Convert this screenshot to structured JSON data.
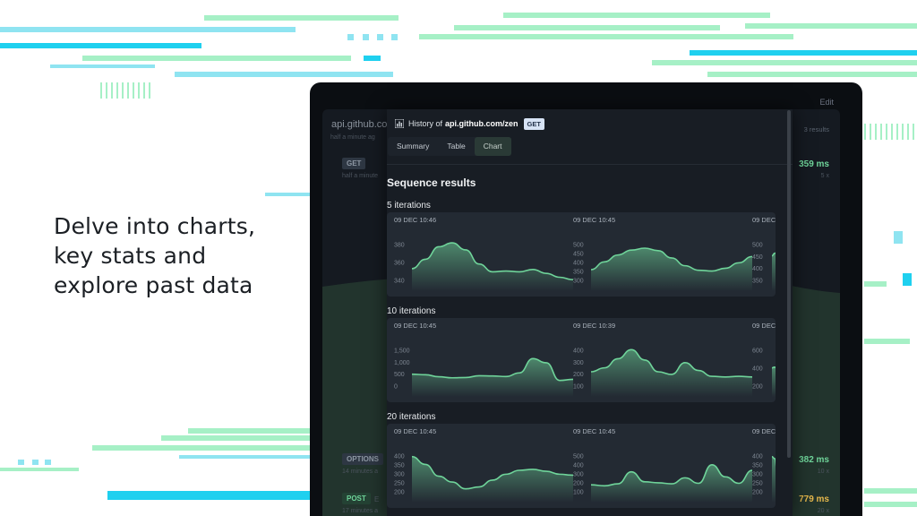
{
  "headline": [
    "Delve into charts,",
    "key stats and",
    "explore past data"
  ],
  "device": {
    "edit_label": "Edit",
    "background": {
      "title": "api.github.co",
      "subtitle": "half a minute ag",
      "results": "3 results",
      "rows": [
        {
          "method": "GET",
          "sub": "half a minute",
          "time": "359 ms",
          "iter": "5 x"
        },
        {
          "method": "OPTIONS",
          "sub": "14 minutes a",
          "time": "382 ms",
          "iter": "10 x"
        },
        {
          "method": "POST",
          "sub": "17 minutes a",
          "time": "779 ms",
          "iter": "20 x"
        }
      ],
      "post_extra": "E"
    }
  },
  "modal": {
    "history_label": "History of",
    "url": "api.github.com/zen",
    "method": "GET",
    "tabs": [
      "Summary",
      "Table",
      "Chart"
    ],
    "active_tab": "Chart",
    "heading": "Sequence results",
    "accent_color": "#6fd49a",
    "sections": [
      {
        "label": "5 iterations"
      },
      {
        "label": "10 iterations"
      },
      {
        "label": "20 iterations"
      }
    ]
  },
  "chart_data": [
    {
      "type": "area",
      "section": "5 iterations",
      "date": "09 DEC 10:46",
      "y_ticks": [
        380,
        360,
        340
      ],
      "ylim": [
        335,
        390
      ],
      "values": [
        350,
        362,
        378,
        383,
        374,
        356,
        346,
        347,
        346,
        349,
        344,
        339,
        336
      ]
    },
    {
      "type": "area",
      "section": "5 iterations",
      "date": "09 DEC 10:45",
      "y_ticks": [
        500,
        450,
        400,
        350,
        300
      ],
      "ylim": [
        290,
        510
      ],
      "values": [
        345,
        385,
        420,
        445,
        455,
        442,
        405,
        365,
        342,
        338,
        352,
        380,
        412
      ]
    },
    {
      "type": "area",
      "section": "5 iterations",
      "date": "09 DEC",
      "y_ticks": [
        500,
        450,
        400,
        350
      ],
      "ylim": [
        340,
        515
      ],
      "values": [
        440,
        450,
        455
      ]
    },
    {
      "type": "area",
      "section": "10 iterations",
      "date": "09 DEC 10:45",
      "y_ticks": [
        "1,500",
        "1,000",
        "500",
        "0"
      ],
      "ylim": [
        -60,
        1600
      ],
      "values": [
        400,
        380,
        300,
        260,
        270,
        340,
        330,
        310,
        450,
        1000,
        840,
        160,
        200
      ]
    },
    {
      "type": "area",
      "section": "10 iterations",
      "date": "09 DEC 10:39",
      "y_ticks": [
        400,
        300,
        200,
        100
      ],
      "ylim": [
        90,
        420
      ],
      "values": [
        200,
        230,
        300,
        370,
        290,
        200,
        180,
        270,
        210,
        165,
        160,
        165,
        160
      ]
    },
    {
      "type": "area",
      "section": "10 iterations",
      "date": "09 DEC",
      "y_ticks": [
        600,
        400,
        200
      ],
      "ylim": [
        180,
        700
      ],
      "values": [
        400,
        410,
        390
      ]
    },
    {
      "type": "area",
      "section": "20 iterations",
      "date": "09 DEC 10:45",
      "y_ticks": [
        400,
        350,
        300,
        250,
        200
      ],
      "ylim": [
        190,
        410
      ],
      "values": [
        370,
        330,
        270,
        240,
        205,
        215,
        250,
        280,
        300,
        305,
        295,
        280,
        275
      ]
    },
    {
      "type": "area",
      "section": "20 iterations",
      "date": "09 DEC 10:45",
      "y_ticks": [
        500,
        400,
        300,
        200,
        100
      ],
      "ylim": [
        80,
        510
      ],
      "values": [
        150,
        140,
        160,
        280,
        180,
        170,
        160,
        220,
        165,
        350,
        230,
        165,
        295
      ]
    },
    {
      "type": "area",
      "section": "20 iterations",
      "date": "09 DEC",
      "y_ticks": [
        400,
        350,
        300,
        250,
        200
      ],
      "ylim": [
        190,
        410
      ],
      "values": [
        370,
        360,
        300
      ]
    }
  ]
}
